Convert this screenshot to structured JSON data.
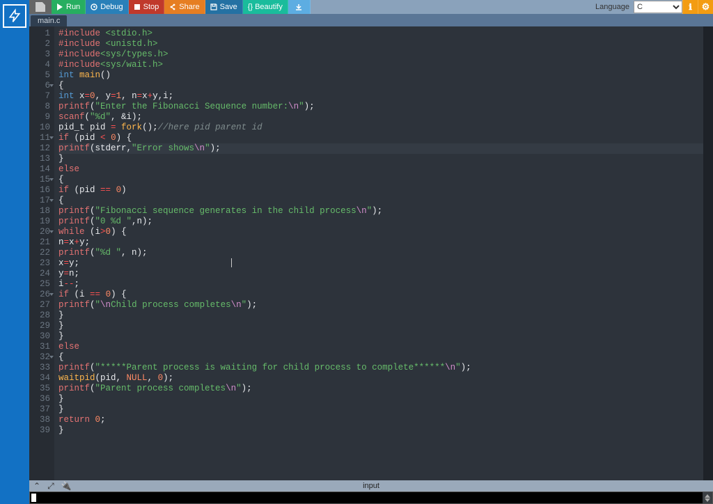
{
  "toolbar": {
    "run": "Run",
    "debug": "Debug",
    "stop": "Stop",
    "share": "Share",
    "save": "Save",
    "beautify": "{} Beautify",
    "language_label": "Language",
    "language_value": "C"
  },
  "tab": {
    "filename": "main.c"
  },
  "gutter": {
    "lines": [
      "1",
      "2",
      "3",
      "4",
      "5",
      "6",
      "7",
      "8",
      "9",
      "10",
      "11",
      "12",
      "13",
      "14",
      "15",
      "16",
      "17",
      "18",
      "19",
      "20",
      "21",
      "22",
      "23",
      "24",
      "25",
      "26",
      "27",
      "28",
      "29",
      "30",
      "31",
      "32",
      "33",
      "34",
      "35",
      "36",
      "37",
      "38",
      "39"
    ]
  },
  "fold_lines": [
    6,
    11,
    15,
    17,
    20,
    26,
    32
  ],
  "highlight_line": 12,
  "code_tokens": [
    [
      [
        "pp",
        "#include "
      ],
      [
        "hdr",
        "<stdio.h>"
      ]
    ],
    [
      [
        "pp",
        "#include "
      ],
      [
        "hdr",
        "<unistd.h>"
      ]
    ],
    [
      [
        "pp",
        "#include"
      ],
      [
        "hdr",
        "<sys/types.h>"
      ]
    ],
    [
      [
        "pp",
        "#include"
      ],
      [
        "hdr",
        "<sys/wait.h>"
      ]
    ],
    [
      [
        "blue",
        "int"
      ],
      [
        "wht",
        " "
      ],
      [
        "fn",
        "main"
      ],
      [
        "wht",
        "()"
      ]
    ],
    [
      [
        "wht",
        "{"
      ]
    ],
    [
      [
        "blue",
        "int "
      ],
      [
        "wht",
        "x"
      ],
      [
        "op",
        "="
      ],
      [
        "num",
        "0"
      ],
      [
        "wht",
        ", y"
      ],
      [
        "op",
        "="
      ],
      [
        "num",
        "1"
      ],
      [
        "wht",
        ", n"
      ],
      [
        "op",
        "="
      ],
      [
        "wht",
        "x"
      ],
      [
        "op",
        "+"
      ],
      [
        "wht",
        "y,i;"
      ]
    ],
    [
      [
        "pp",
        "printf"
      ],
      [
        "wht",
        "("
      ],
      [
        "str",
        "\"Enter the Fibonacci Sequence number:"
      ],
      [
        "esc",
        "\\n"
      ],
      [
        "str",
        "\""
      ],
      [
        "wht",
        ");"
      ]
    ],
    [
      [
        "pp",
        "scanf"
      ],
      [
        "wht",
        "("
      ],
      [
        "str",
        "\"%d\""
      ],
      [
        "wht",
        ", &i);"
      ]
    ],
    [
      [
        "wht",
        "pid_t pid "
      ],
      [
        "op",
        "="
      ],
      [
        "wht",
        " "
      ],
      [
        "fn",
        "fork"
      ],
      [
        "wht",
        "();"
      ],
      [
        "cmt",
        "//here pid parent id"
      ]
    ],
    [
      [
        "pp",
        "if"
      ],
      [
        "wht",
        " (pid "
      ],
      [
        "op",
        "<"
      ],
      [
        "wht",
        " "
      ],
      [
        "num",
        "0"
      ],
      [
        "wht",
        ") {"
      ]
    ],
    [
      [
        "pp",
        "printf"
      ],
      [
        "wht",
        "(stderr,"
      ],
      [
        "str",
        "\"Error shows"
      ],
      [
        "esc",
        "\\n"
      ],
      [
        "str",
        "\""
      ],
      [
        "wht",
        ");"
      ]
    ],
    [
      [
        "wht",
        "}"
      ]
    ],
    [
      [
        "pp",
        "else"
      ]
    ],
    [
      [
        "wht",
        "{"
      ]
    ],
    [
      [
        "pp",
        "if"
      ],
      [
        "wht",
        " (pid "
      ],
      [
        "op",
        "=="
      ],
      [
        "wht",
        " "
      ],
      [
        "num",
        "0"
      ],
      [
        "wht",
        ")"
      ]
    ],
    [
      [
        "wht",
        "{"
      ]
    ],
    [
      [
        "pp",
        "printf"
      ],
      [
        "wht",
        "("
      ],
      [
        "str",
        "\"Fibonacci sequence generates in the child process"
      ],
      [
        "esc",
        "\\n"
      ],
      [
        "str",
        "\""
      ],
      [
        "wht",
        ");"
      ]
    ],
    [
      [
        "pp",
        "printf"
      ],
      [
        "wht",
        "("
      ],
      [
        "str",
        "\"0 %d \""
      ],
      [
        "wht",
        ",n);"
      ]
    ],
    [
      [
        "pp",
        "while"
      ],
      [
        "wht",
        " (i"
      ],
      [
        "op",
        ">"
      ],
      [
        "num",
        "0"
      ],
      [
        "wht",
        ") {"
      ]
    ],
    [
      [
        "wht",
        "n"
      ],
      [
        "op",
        "="
      ],
      [
        "wht",
        "x"
      ],
      [
        "op",
        "+"
      ],
      [
        "wht",
        "y;"
      ]
    ],
    [
      [
        "pp",
        "printf"
      ],
      [
        "wht",
        "("
      ],
      [
        "str",
        "\"%d \""
      ],
      [
        "wht",
        ", n);"
      ]
    ],
    [
      [
        "wht",
        "x"
      ],
      [
        "op",
        "="
      ],
      [
        "wht",
        "y;"
      ]
    ],
    [
      [
        "wht",
        "y"
      ],
      [
        "op",
        "="
      ],
      [
        "wht",
        "n;"
      ]
    ],
    [
      [
        "wht",
        "i"
      ],
      [
        "op",
        "--"
      ],
      [
        "wht",
        ";"
      ]
    ],
    [
      [
        "pp",
        "if"
      ],
      [
        "wht",
        " (i "
      ],
      [
        "op",
        "=="
      ],
      [
        "wht",
        " "
      ],
      [
        "num",
        "0"
      ],
      [
        "wht",
        ") {"
      ]
    ],
    [
      [
        "pp",
        "printf"
      ],
      [
        "wht",
        "("
      ],
      [
        "str",
        "\""
      ],
      [
        "esc",
        "\\n"
      ],
      [
        "str",
        "Child process completes"
      ],
      [
        "esc",
        "\\n"
      ],
      [
        "str",
        "\""
      ],
      [
        "wht",
        ");"
      ]
    ],
    [
      [
        "wht",
        "}"
      ]
    ],
    [
      [
        "wht",
        "}"
      ]
    ],
    [
      [
        "wht",
        "}"
      ]
    ],
    [
      [
        "pp",
        "else"
      ]
    ],
    [
      [
        "wht",
        "{"
      ]
    ],
    [
      [
        "pp",
        "printf"
      ],
      [
        "wht",
        "("
      ],
      [
        "str",
        "\"*****Parent process is waiting for child process to complete******"
      ],
      [
        "esc",
        "\\n"
      ],
      [
        "str",
        "\""
      ],
      [
        "wht",
        ");"
      ]
    ],
    [
      [
        "fn",
        "waitpid"
      ],
      [
        "wht",
        "(pid, "
      ],
      [
        "num",
        "NULL"
      ],
      [
        "wht",
        ", "
      ],
      [
        "num",
        "0"
      ],
      [
        "wht",
        ");"
      ]
    ],
    [
      [
        "pp",
        "printf"
      ],
      [
        "wht",
        "("
      ],
      [
        "str",
        "\"Parent process completes"
      ],
      [
        "esc",
        "\\n"
      ],
      [
        "str",
        "\""
      ],
      [
        "wht",
        ");"
      ]
    ],
    [
      [
        "wht",
        "}"
      ]
    ],
    [
      [
        "wht",
        "}"
      ]
    ],
    [
      [
        "pp",
        "return"
      ],
      [
        "wht",
        " "
      ],
      [
        "num",
        "0"
      ],
      [
        "wht",
        ";"
      ]
    ],
    [
      [
        "wht",
        "}"
      ]
    ]
  ],
  "bottom": {
    "input_label": "input"
  }
}
